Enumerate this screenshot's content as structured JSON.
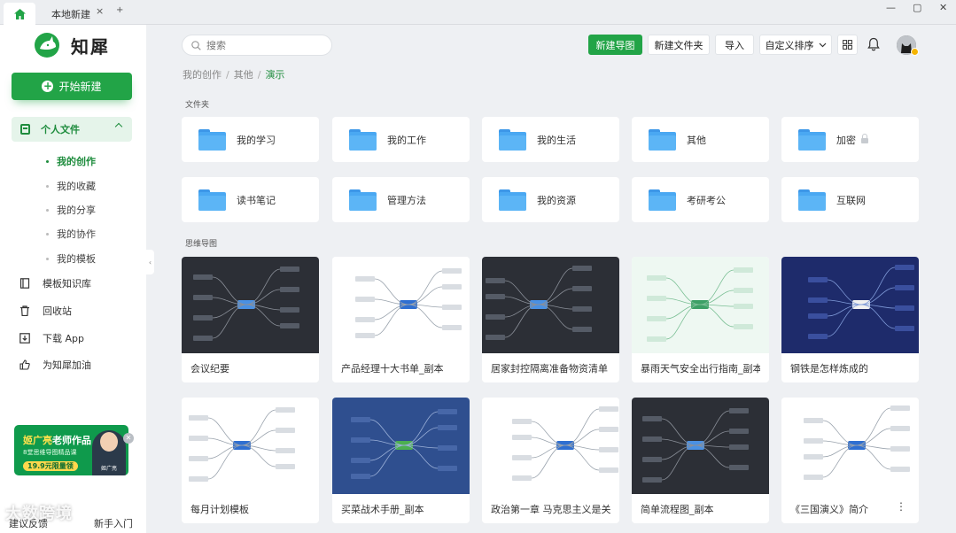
{
  "tabs": {
    "doc_tab": "本地新建",
    "close": "×",
    "add": "+"
  },
  "window": {
    "min": "—",
    "max": "▢",
    "close": "✕"
  },
  "app": {
    "name": "知犀"
  },
  "sidebar": {
    "new_button": "开始新建",
    "personal_files": "个人文件",
    "sub_items": [
      {
        "label": "我的创作",
        "active": true
      },
      {
        "label": "我的收藏",
        "active": false
      },
      {
        "label": "我的分享",
        "active": false
      },
      {
        "label": "我的协作",
        "active": false
      },
      {
        "label": "我的模板",
        "active": false
      }
    ],
    "nav_items": [
      {
        "label": "模板知识库",
        "icon": "book-icon"
      },
      {
        "label": "回收站",
        "icon": "trash-icon"
      },
      {
        "label": "下载 App",
        "icon": "download-icon"
      },
      {
        "label": "为知犀加油",
        "icon": "thumbs-up-icon"
      }
    ],
    "promo": {
      "line1a": "姬广亮",
      "line1b": "老师作品",
      "line2": "8堂思维导图精品课",
      "line3": "19.9元限量领",
      "name": "姬广亮"
    },
    "bottom_left": "建议反馈",
    "bottom_right": "新手入门",
    "watermark": "大数跨境"
  },
  "toolbar": {
    "search_placeholder": "搜索",
    "new_mindmap": "新建导图",
    "new_folder": "新建文件夹",
    "import": "导入",
    "sort": "自定义排序"
  },
  "breadcrumb": [
    "我的创作",
    "其他",
    "演示"
  ],
  "sections": {
    "folders": "文件夹",
    "mindmaps": "思维导图"
  },
  "folders": [
    {
      "name": "我的学习",
      "locked": false
    },
    {
      "name": "我的工作",
      "locked": false
    },
    {
      "name": "我的生活",
      "locked": false
    },
    {
      "name": "其他",
      "locked": false
    },
    {
      "name": "加密",
      "locked": true
    },
    {
      "name": "读书笔记",
      "locked": false
    },
    {
      "name": "管理方法",
      "locked": false
    },
    {
      "name": "我的资源",
      "locked": false
    },
    {
      "name": "考研考公",
      "locked": false
    },
    {
      "name": "互联网",
      "locked": false
    }
  ],
  "mindmaps": [
    {
      "title": "会议纪要",
      "theme": "dark"
    },
    {
      "title": "产品经理十大书单_副本",
      "theme": "light"
    },
    {
      "title": "居家封控隔离准备物资清单",
      "theme": "dark"
    },
    {
      "title": "暴雨天气安全出行指南_副本",
      "theme": "mint"
    },
    {
      "title": "钢铁是怎样炼成的",
      "theme": "navy"
    },
    {
      "title": "每月计划模板",
      "theme": "light"
    },
    {
      "title": "买菜战术手册_副本",
      "theme": "blue"
    },
    {
      "title": "政治第一章 马克思主义是关于...",
      "theme": "light"
    },
    {
      "title": "简单流程图_副本",
      "theme": "dark"
    },
    {
      "title": "《三国演义》简介",
      "theme": "light"
    }
  ],
  "colors": {
    "brand": "#22a447",
    "folder": "#4aa8f2",
    "background": "#eef0f3"
  }
}
